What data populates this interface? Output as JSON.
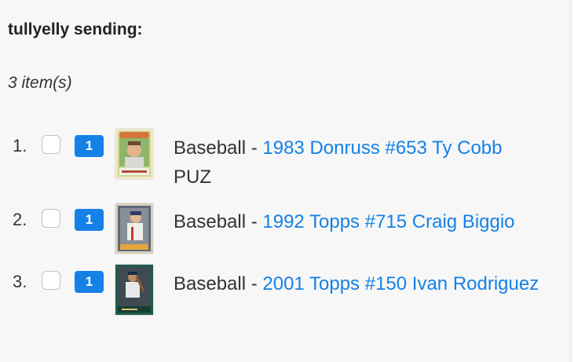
{
  "heading": "tullyelly sending:",
  "item_count": "3 item(s)",
  "colors": {
    "link": "#1581e6",
    "qty_badge": "#1581e6",
    "panel_bg": "#f7f7f7"
  },
  "items": [
    {
      "number": "1.",
      "quantity": "1",
      "sport": "Baseball - ",
      "card": "1983 Donruss #653 Ty Cobb",
      "extra": "PUZ",
      "thumbnail": "card-thumbnail"
    },
    {
      "number": "2.",
      "quantity": "1",
      "sport": "Baseball - ",
      "card": "1992 Topps #715 Craig Biggio",
      "extra": "",
      "thumbnail": "card-thumbnail"
    },
    {
      "number": "3.",
      "quantity": "1",
      "sport": "Baseball - ",
      "card": "2001 Topps #150 Ivan Rodriguez",
      "extra": "",
      "thumbnail": "card-thumbnail"
    }
  ]
}
